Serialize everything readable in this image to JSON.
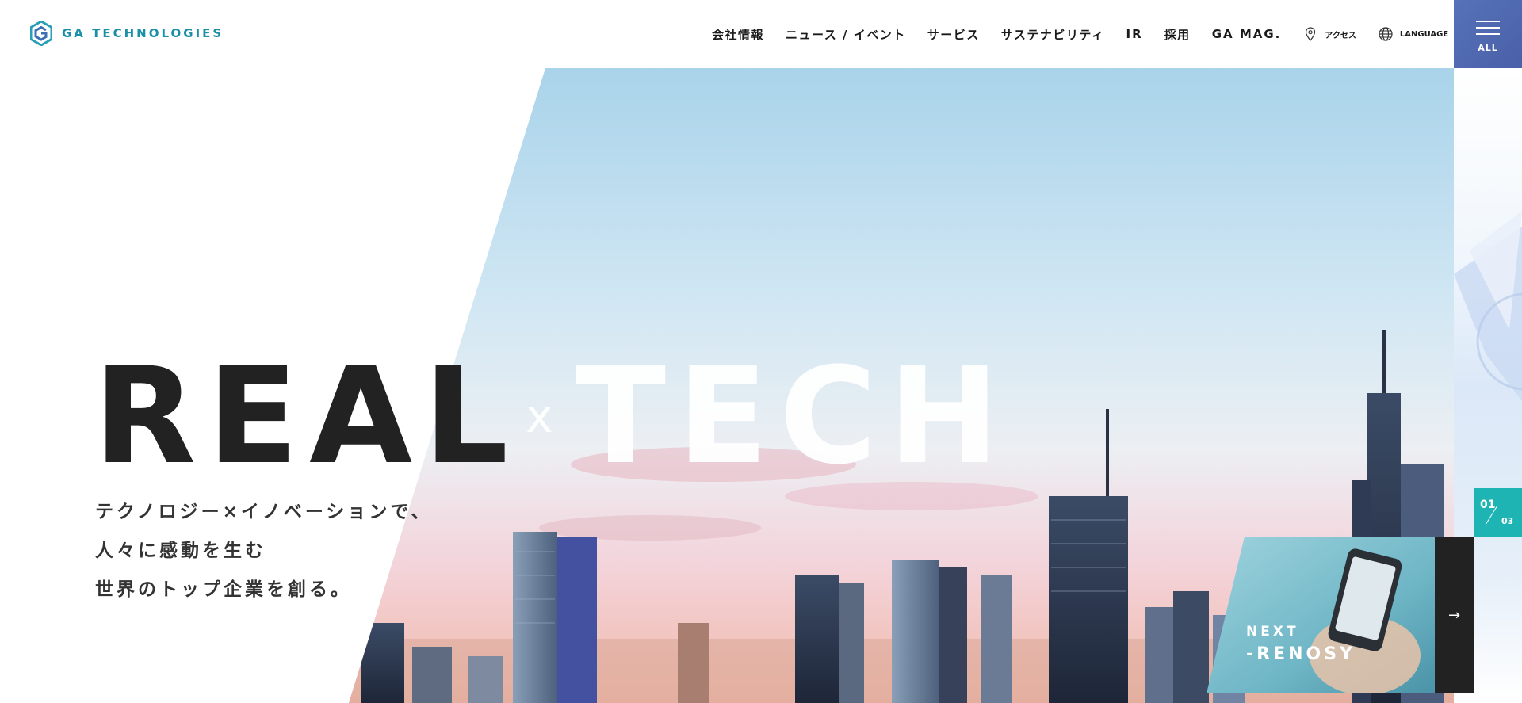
{
  "brand": {
    "name": "GA TECHNOLOGIES",
    "color": "#1a8fa6"
  },
  "nav": {
    "items": [
      {
        "label": "会社情報"
      },
      {
        "label": "ニュース / イベント"
      },
      {
        "label": "サービス"
      },
      {
        "label": "サステナビリティ"
      },
      {
        "label": "IR"
      },
      {
        "label": "採用"
      },
      {
        "label": "GA MAG."
      }
    ],
    "access_label": "アクセス",
    "language_label": "LANGUAGE",
    "menu_label": "ALL"
  },
  "hero": {
    "headline_left": "REAL",
    "headline_x": "x",
    "headline_right": "TECH",
    "subcopy": [
      "テクノロジー×イノベーションで、",
      "人々に感動を生む",
      "世界のトップ企業を創る。"
    ]
  },
  "slider": {
    "current": "01",
    "total": "03",
    "next_label": "NEXT",
    "next_title": "-RENOSY",
    "accent_color": "#1fb4b4"
  },
  "colors": {
    "menu_bg": "#5672b8",
    "dark": "#222222"
  }
}
